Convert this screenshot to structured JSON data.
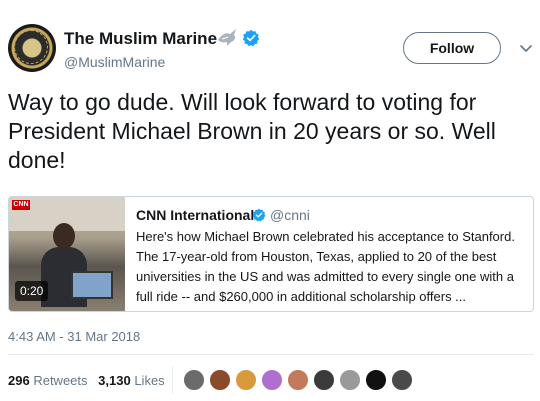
{
  "user": {
    "display_name": "The Muslim Marine",
    "handle": "@MuslimMarine"
  },
  "follow_label": "Follow",
  "tweet_text": "Way to go dude.  Will look forward to voting for President Michael Brown in 20 years or so.  Well done!",
  "quoted_tweet": {
    "name": "CNN International",
    "handle": "@cnni",
    "text": "Here's how Michael Brown celebrated his acceptance to Stanford. The 17-year-old from Houston, Texas, applied to 20 of the best universities in the US and was admitted to every single one with a full ride -- and $260,000 in additional scholarship offers ...",
    "video_duration": "0:20",
    "thumb_badge": "CNN"
  },
  "timestamp": "4:43 AM - 31 Mar 2018",
  "stats": {
    "retweets_count": "296",
    "retweets_label": "Retweets",
    "likes_count": "3,130",
    "likes_label": "Likes"
  },
  "colors": {
    "verified": "#1da1f2",
    "secondary_text": "#657786",
    "border": "#ccd6dd"
  },
  "icons": [
    "dove-icon",
    "verified-icon",
    "chevron-down-icon"
  ],
  "likers": [
    {
      "avatar_color": "#6b6b6b"
    },
    {
      "avatar_color": "#8a4a2c"
    },
    {
      "avatar_color": "#d89a3a"
    },
    {
      "avatar_color": "#b06fcf"
    },
    {
      "avatar_color": "#c27a5a"
    },
    {
      "avatar_color": "#3b3b3b"
    },
    {
      "avatar_color": "#9a9a9a"
    },
    {
      "avatar_color": "#111111"
    },
    {
      "avatar_color": "#4a4a4a"
    }
  ]
}
